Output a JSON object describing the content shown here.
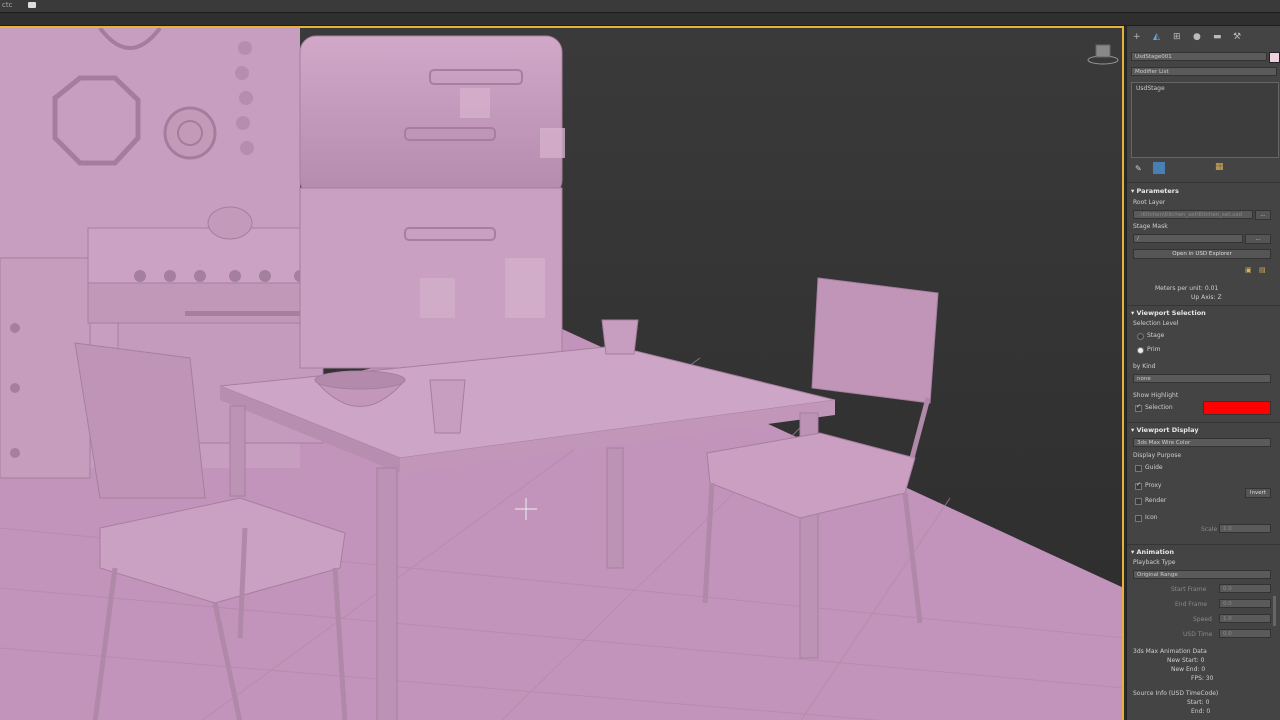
{
  "window": {
    "title": "ctc"
  },
  "command_panel": {
    "tab_icons": [
      "create-icon",
      "modify-icon",
      "hierarchy-icon",
      "motion-icon",
      "display-icon",
      "utilities-icon"
    ],
    "object_name": "UsdStage001",
    "modifier_list": "Modifier List",
    "stack_item": "UsdStage",
    "parameters": {
      "header": "Parameters",
      "root_layer_label": "Root Layer",
      "root_layer_value": "..\\Kitchen\\Kitchen_set\\Kitchen_set.usd",
      "stage_mask_label": "Stage Mask",
      "stage_mask_value": "/",
      "browse_label": "...",
      "open_explorer": "Open in USD Explorer",
      "meters_per_unit": "Meters per unit: 0.01",
      "up_axis": "Up Axis: Z"
    },
    "viewport_selection": {
      "header": "Viewport Selection",
      "selection_level_label": "Selection Level",
      "stage": "Stage",
      "prim": "Prim",
      "by_kind_label": "by Kind",
      "by_kind_value": "none",
      "show_highlight_label": "Show Highlight",
      "selection": "Selection",
      "highlight_color": "#ff0000"
    },
    "viewport_display": {
      "header": "Viewport Display",
      "color_mode": "3ds Max Wire Color",
      "display_purpose_label": "Display Purpose",
      "guide": "Guide",
      "proxy": "Proxy",
      "render": "Render",
      "icon": "Icon",
      "invert": "Invert",
      "scale_label": "Scale",
      "scale_value": "1.0"
    },
    "animation": {
      "header": "Animation",
      "playback_type_label": "Playback Type",
      "playback_type_value": "Original Range",
      "start_frame_label": "Start Frame",
      "start_frame_value": "0.0",
      "end_frame_label": "End Frame",
      "end_frame_value": "0.0",
      "speed_label": "Speed",
      "speed_value": "1.0",
      "usd_time_label": "USD Time",
      "usd_time_value": "0.0",
      "max_anim_label": "3ds Max Animation Data",
      "new_start": "New Start: 0",
      "new_end": "New End: 0",
      "fps": "FPS: 30",
      "source_info_label": "Source Info (USD TimeCode)",
      "start": "Start: 0",
      "end": "End: 0"
    }
  },
  "colors": {
    "accent": "#e8b23a",
    "model": "#c79cbf"
  }
}
